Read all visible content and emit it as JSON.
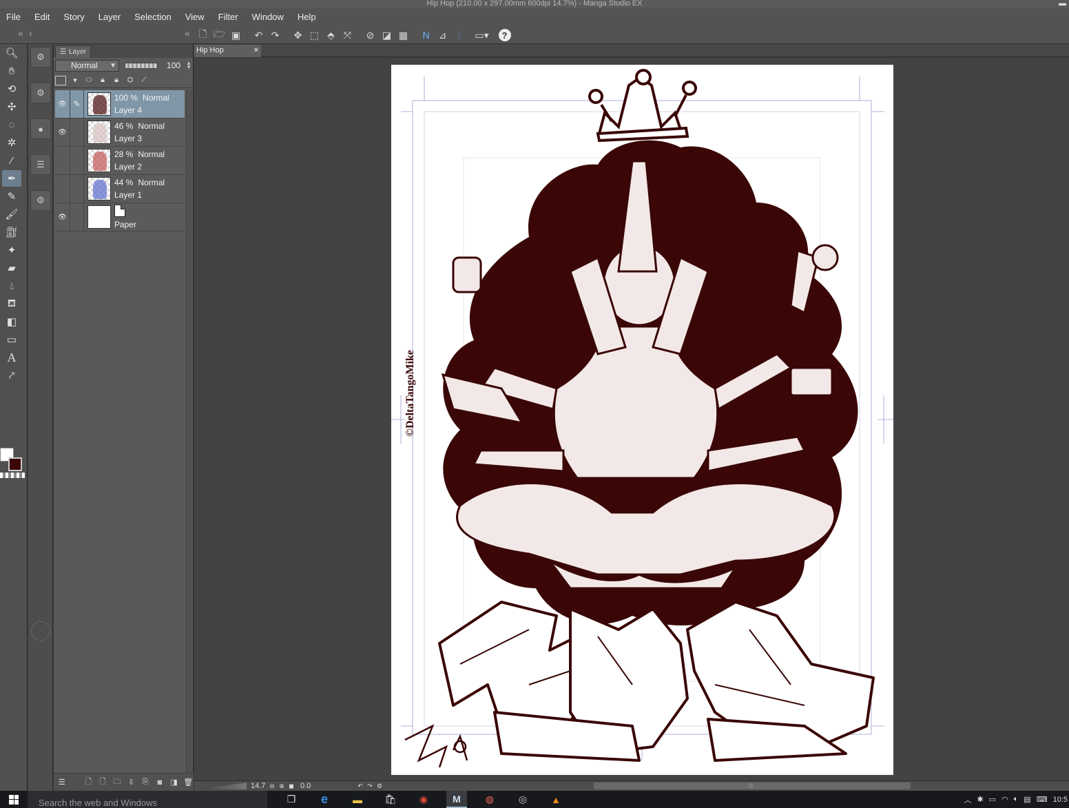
{
  "window": {
    "title": "Hip Hop (210.00 x 297.00mm 600dpi 14.7%)  - Manga Studio EX"
  },
  "menu": [
    "File",
    "Edit",
    "Story",
    "Layer",
    "Selection",
    "View",
    "Filter",
    "Window",
    "Help"
  ],
  "command_bar": {
    "icons": [
      "new-file-icon",
      "open-file-icon",
      "save-icon",
      "undo-icon",
      "redo-icon",
      "transform-icon",
      "scale-icon",
      "fill-icon",
      "fit-icon",
      "clear-icon",
      "deselect-icon",
      "select-all-icon",
      "ruler-icon",
      "perspective-icon",
      "snap-icon",
      "layout-icon",
      "help-icon"
    ],
    "help_label": "?"
  },
  "toolbox": {
    "tools": [
      "zoom-icon",
      "hand-icon",
      "rotate-icon",
      "move-icon",
      "lasso-icon",
      "magic-wand-icon",
      "eyedropper-icon",
      "pen-icon",
      "pencil-icon",
      "brush-icon",
      "airbrush-icon",
      "decoration-icon",
      "eraser-icon",
      "blend-icon",
      "fill-bucket-icon",
      "gradient-icon",
      "rectangle-icon",
      "text-icon",
      "correct-line-icon"
    ],
    "main_color": "#ffffff",
    "sub_color": "#3a0606"
  },
  "layer_panel": {
    "tab_label": "Layer",
    "blend_mode": "Normal",
    "opacity": "100",
    "layers": [
      {
        "name": "Layer 4",
        "opacity": "100 %",
        "mode": "Normal",
        "visible": true,
        "selected": true,
        "editing": true,
        "thumb_color": "#4a0b0b"
      },
      {
        "name": "Layer 3",
        "opacity": "46 %",
        "mode": "Normal",
        "visible": true,
        "selected": false,
        "editing": false,
        "thumb_color": "#d8c0c0"
      },
      {
        "name": "Layer 2",
        "opacity": "28 %",
        "mode": "Normal",
        "visible": false,
        "selected": false,
        "editing": false,
        "thumb_color": "#c45454"
      },
      {
        "name": "Layer 1",
        "opacity": "44 %",
        "mode": "Normal",
        "visible": false,
        "selected": false,
        "editing": false,
        "thumb_color": "#5b6bd0"
      }
    ],
    "paper": {
      "name": "Paper",
      "visible": true
    }
  },
  "document_tab": {
    "label": "Hip Hop",
    "close": "×"
  },
  "canvas": {
    "artwork_color": "#3a0606",
    "signature": "©DeltaTangoMike"
  },
  "status_bar": {
    "zoom": "14.7",
    "angle": "0.0"
  },
  "taskbar": {
    "search_placeholder": "Search the web and Windows",
    "apps": [
      "task-view-icon",
      "edge-icon",
      "file-explorer-icon",
      "store-icon",
      "chrome-icon",
      "manga-studio-icon",
      "photo-app-icon",
      "obs-icon",
      "vlc-icon"
    ],
    "clock": "10:5"
  }
}
